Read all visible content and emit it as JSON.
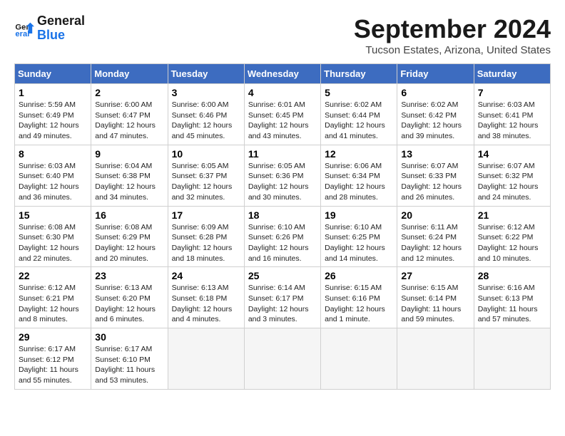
{
  "logo": {
    "line1": "General",
    "line2": "Blue"
  },
  "title": "September 2024",
  "location": "Tucson Estates, Arizona, United States",
  "days_of_week": [
    "Sunday",
    "Monday",
    "Tuesday",
    "Wednesday",
    "Thursday",
    "Friday",
    "Saturday"
  ],
  "weeks": [
    [
      {
        "day": 1,
        "info": "Sunrise: 5:59 AM\nSunset: 6:49 PM\nDaylight: 12 hours\nand 49 minutes."
      },
      {
        "day": 2,
        "info": "Sunrise: 6:00 AM\nSunset: 6:47 PM\nDaylight: 12 hours\nand 47 minutes."
      },
      {
        "day": 3,
        "info": "Sunrise: 6:00 AM\nSunset: 6:46 PM\nDaylight: 12 hours\nand 45 minutes."
      },
      {
        "day": 4,
        "info": "Sunrise: 6:01 AM\nSunset: 6:45 PM\nDaylight: 12 hours\nand 43 minutes."
      },
      {
        "day": 5,
        "info": "Sunrise: 6:02 AM\nSunset: 6:44 PM\nDaylight: 12 hours\nand 41 minutes."
      },
      {
        "day": 6,
        "info": "Sunrise: 6:02 AM\nSunset: 6:42 PM\nDaylight: 12 hours\nand 39 minutes."
      },
      {
        "day": 7,
        "info": "Sunrise: 6:03 AM\nSunset: 6:41 PM\nDaylight: 12 hours\nand 38 minutes."
      }
    ],
    [
      {
        "day": 8,
        "info": "Sunrise: 6:03 AM\nSunset: 6:40 PM\nDaylight: 12 hours\nand 36 minutes."
      },
      {
        "day": 9,
        "info": "Sunrise: 6:04 AM\nSunset: 6:38 PM\nDaylight: 12 hours\nand 34 minutes."
      },
      {
        "day": 10,
        "info": "Sunrise: 6:05 AM\nSunset: 6:37 PM\nDaylight: 12 hours\nand 32 minutes."
      },
      {
        "day": 11,
        "info": "Sunrise: 6:05 AM\nSunset: 6:36 PM\nDaylight: 12 hours\nand 30 minutes."
      },
      {
        "day": 12,
        "info": "Sunrise: 6:06 AM\nSunset: 6:34 PM\nDaylight: 12 hours\nand 28 minutes."
      },
      {
        "day": 13,
        "info": "Sunrise: 6:07 AM\nSunset: 6:33 PM\nDaylight: 12 hours\nand 26 minutes."
      },
      {
        "day": 14,
        "info": "Sunrise: 6:07 AM\nSunset: 6:32 PM\nDaylight: 12 hours\nand 24 minutes."
      }
    ],
    [
      {
        "day": 15,
        "info": "Sunrise: 6:08 AM\nSunset: 6:30 PM\nDaylight: 12 hours\nand 22 minutes."
      },
      {
        "day": 16,
        "info": "Sunrise: 6:08 AM\nSunset: 6:29 PM\nDaylight: 12 hours\nand 20 minutes."
      },
      {
        "day": 17,
        "info": "Sunrise: 6:09 AM\nSunset: 6:28 PM\nDaylight: 12 hours\nand 18 minutes."
      },
      {
        "day": 18,
        "info": "Sunrise: 6:10 AM\nSunset: 6:26 PM\nDaylight: 12 hours\nand 16 minutes."
      },
      {
        "day": 19,
        "info": "Sunrise: 6:10 AM\nSunset: 6:25 PM\nDaylight: 12 hours\nand 14 minutes."
      },
      {
        "day": 20,
        "info": "Sunrise: 6:11 AM\nSunset: 6:24 PM\nDaylight: 12 hours\nand 12 minutes."
      },
      {
        "day": 21,
        "info": "Sunrise: 6:12 AM\nSunset: 6:22 PM\nDaylight: 12 hours\nand 10 minutes."
      }
    ],
    [
      {
        "day": 22,
        "info": "Sunrise: 6:12 AM\nSunset: 6:21 PM\nDaylight: 12 hours\nand 8 minutes."
      },
      {
        "day": 23,
        "info": "Sunrise: 6:13 AM\nSunset: 6:20 PM\nDaylight: 12 hours\nand 6 minutes."
      },
      {
        "day": 24,
        "info": "Sunrise: 6:13 AM\nSunset: 6:18 PM\nDaylight: 12 hours\nand 4 minutes."
      },
      {
        "day": 25,
        "info": "Sunrise: 6:14 AM\nSunset: 6:17 PM\nDaylight: 12 hours\nand 3 minutes."
      },
      {
        "day": 26,
        "info": "Sunrise: 6:15 AM\nSunset: 6:16 PM\nDaylight: 12 hours\nand 1 minute."
      },
      {
        "day": 27,
        "info": "Sunrise: 6:15 AM\nSunset: 6:14 PM\nDaylight: 11 hours\nand 59 minutes."
      },
      {
        "day": 28,
        "info": "Sunrise: 6:16 AM\nSunset: 6:13 PM\nDaylight: 11 hours\nand 57 minutes."
      }
    ],
    [
      {
        "day": 29,
        "info": "Sunrise: 6:17 AM\nSunset: 6:12 PM\nDaylight: 11 hours\nand 55 minutes."
      },
      {
        "day": 30,
        "info": "Sunrise: 6:17 AM\nSunset: 6:10 PM\nDaylight: 11 hours\nand 53 minutes."
      },
      null,
      null,
      null,
      null,
      null
    ]
  ]
}
